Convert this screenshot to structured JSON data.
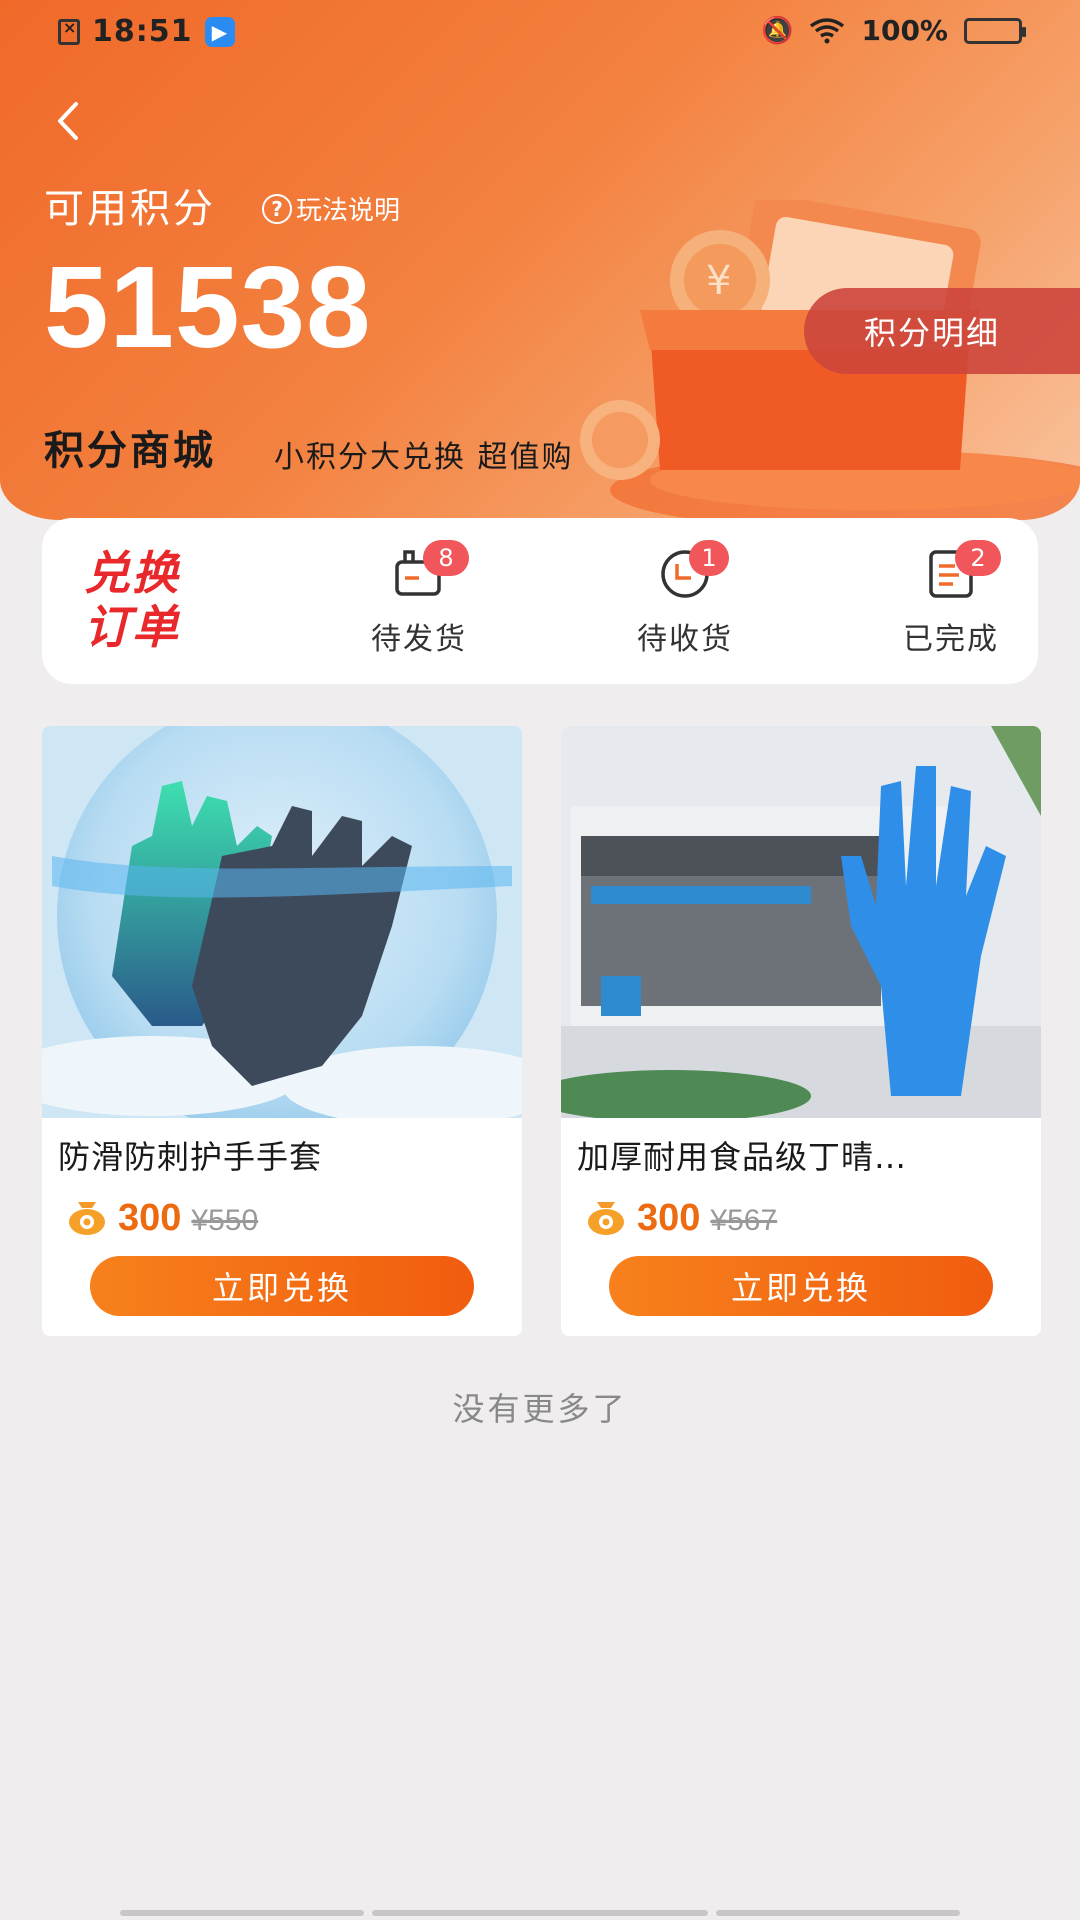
{
  "status_bar": {
    "time": "18:51",
    "battery": "100%"
  },
  "header": {
    "available_label": "可用积分",
    "rules_label": "玩法说明",
    "points": "51538",
    "detail_button": "积分明细",
    "mall_title": "积分商城",
    "mall_subtitle": "小积分大兑换 超值购"
  },
  "orders": {
    "title_line1": "兑换",
    "title_line2": "订单",
    "items": [
      {
        "label": "待发货",
        "badge": "8",
        "icon": "package-icon"
      },
      {
        "label": "待收货",
        "badge": "1",
        "icon": "truck-icon"
      },
      {
        "label": "已完成",
        "badge": "2",
        "icon": "document-icon"
      }
    ]
  },
  "products": [
    {
      "name": "防滑防刺护手手套",
      "points": "300",
      "original_price": "¥550",
      "button": "立即兑换",
      "image": "work-gloves-image"
    },
    {
      "name": "加厚耐用食品级丁晴…",
      "points": "300",
      "original_price": "¥567",
      "button": "立即兑换",
      "image": "nitrile-gloves-image"
    }
  ],
  "footer": {
    "no_more": "没有更多了"
  },
  "colors": {
    "accent": "#f0692a",
    "price": "#ec6a10",
    "badge": "#f0565a",
    "orders_title": "#e8282b"
  }
}
